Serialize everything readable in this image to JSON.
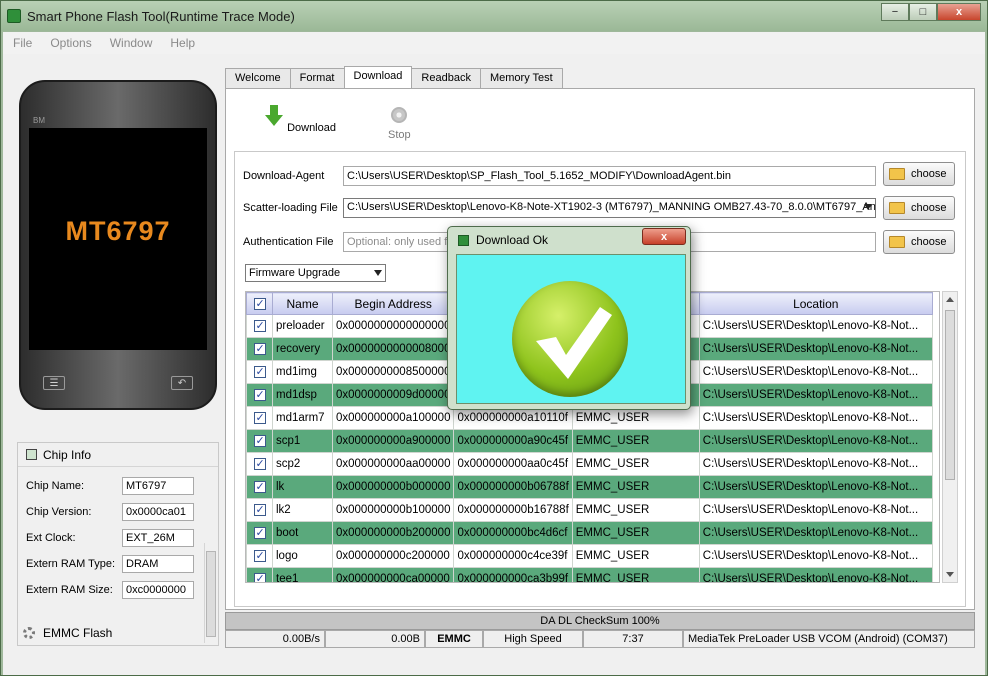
{
  "window": {
    "title": "Smart Phone Flash Tool(Runtime Trace Mode)",
    "controls": {
      "minimize": "−",
      "maximize": "□",
      "close": "x"
    }
  },
  "menu": [
    "File",
    "Options",
    "Window",
    "Help"
  ],
  "phone": {
    "brand": "BM",
    "chip": "MT6797"
  },
  "chip_info": {
    "title": "Chip Info",
    "rows": [
      {
        "label": "Chip Name:",
        "value": "MT6797"
      },
      {
        "label": "Chip Version:",
        "value": "0x0000ca01"
      },
      {
        "label": "Ext Clock:",
        "value": "EXT_26M"
      },
      {
        "label": "Extern RAM Type:",
        "value": "DRAM"
      },
      {
        "label": "Extern RAM Size:",
        "value": "0xc0000000"
      }
    ],
    "emmc_flash": "EMMC Flash"
  },
  "tabs": [
    "Welcome",
    "Format",
    "Download",
    "Readback",
    "Memory Test"
  ],
  "active_tab": "Download",
  "toolbar": {
    "download_label": "Download",
    "stop_label": "Stop"
  },
  "form": {
    "download_agent": {
      "label": "Download-Agent",
      "value": "C:\\Users\\USER\\Desktop\\SP_Flash_Tool_5.1652_MODIFY\\DownloadAgent.bin"
    },
    "scatter": {
      "label": "Scatter-loading File",
      "value": "C:\\Users\\USER\\Desktop\\Lenovo-K8-Note-XT1902-3 (MT6797)_MANNING OMB27.43-70_8.0.0\\MT6797_Andr"
    },
    "auth": {
      "label": "Authentication File",
      "placeholder": "Optional: only used fo"
    },
    "choose_label": "choose",
    "mode": "Firmware Upgrade"
  },
  "table": {
    "headers": [
      "Name",
      "Begin Address",
      "",
      "",
      "Location"
    ],
    "rows": [
      {
        "name": "preloader",
        "begin": "0x0000000000000000",
        "end": "",
        "region": "",
        "location": "C:\\Users\\USER\\Desktop\\Lenovo-K8-Not..."
      },
      {
        "name": "recovery",
        "begin": "0x0000000000008000",
        "end": "",
        "region": "",
        "location": "C:\\Users\\USER\\Desktop\\Lenovo-K8-Not..."
      },
      {
        "name": "md1img",
        "begin": "0x0000000008500000",
        "end": "",
        "region": "",
        "location": "C:\\Users\\USER\\Desktop\\Lenovo-K8-Not..."
      },
      {
        "name": "md1dsp",
        "begin": "0x0000000009d00000",
        "end": "",
        "region": "",
        "location": "C:\\Users\\USER\\Desktop\\Lenovo-K8-Not..."
      },
      {
        "name": "md1arm7",
        "begin": "0x000000000a100000",
        "end": "0x000000000a10110f",
        "region": "EMMC_USER",
        "location": "C:\\Users\\USER\\Desktop\\Lenovo-K8-Not..."
      },
      {
        "name": "scp1",
        "begin": "0x000000000a900000",
        "end": "0x000000000a90c45f",
        "region": "EMMC_USER",
        "location": "C:\\Users\\USER\\Desktop\\Lenovo-K8-Not..."
      },
      {
        "name": "scp2",
        "begin": "0x000000000aa00000",
        "end": "0x000000000aa0c45f",
        "region": "EMMC_USER",
        "location": "C:\\Users\\USER\\Desktop\\Lenovo-K8-Not..."
      },
      {
        "name": "lk",
        "begin": "0x000000000b000000",
        "end": "0x000000000b06788f",
        "region": "EMMC_USER",
        "location": "C:\\Users\\USER\\Desktop\\Lenovo-K8-Not..."
      },
      {
        "name": "lk2",
        "begin": "0x000000000b100000",
        "end": "0x000000000b16788f",
        "region": "EMMC_USER",
        "location": "C:\\Users\\USER\\Desktop\\Lenovo-K8-Not..."
      },
      {
        "name": "boot",
        "begin": "0x000000000b200000",
        "end": "0x000000000bc4d6cf",
        "region": "EMMC_USER",
        "location": "C:\\Users\\USER\\Desktop\\Lenovo-K8-Not..."
      },
      {
        "name": "logo",
        "begin": "0x000000000c200000",
        "end": "0x000000000c4ce39f",
        "region": "EMMC_USER",
        "location": "C:\\Users\\USER\\Desktop\\Lenovo-K8-Not..."
      },
      {
        "name": "tee1",
        "begin": "0x000000000ca00000",
        "end": "0x000000000ca3b99f",
        "region": "EMMC_USER",
        "location": "C:\\Users\\USER\\Desktop\\Lenovo-K8-Not..."
      }
    ]
  },
  "progress": {
    "label": "DA DL CheckSum 100%",
    "percent": 100
  },
  "status": {
    "speed": "0.00B/s",
    "bytes": "0.00B",
    "storage": "EMMC",
    "mode": "High Speed",
    "time": "7:37",
    "port": "MediaTek PreLoader USB VCOM (Android) (COM37)"
  },
  "dialog": {
    "title": "Download Ok",
    "close": "x"
  }
}
